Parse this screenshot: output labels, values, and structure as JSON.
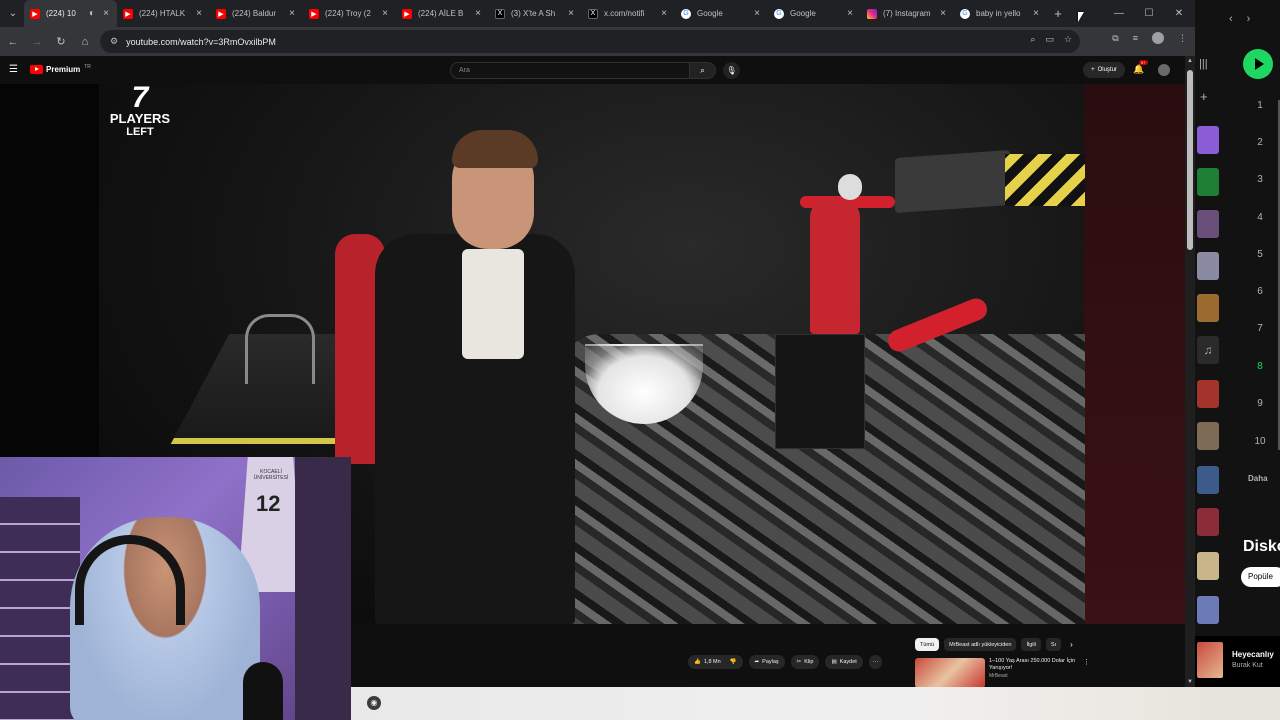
{
  "browser": {
    "tabs": [
      {
        "title": "(224) 10",
        "favicon": "youtube-icon",
        "active": true
      },
      {
        "title": "(224) HTALK",
        "favicon": "youtube-icon",
        "active": false
      },
      {
        "title": "(224) Baldur",
        "favicon": "youtube-icon",
        "active": false
      },
      {
        "title": "(224) Troy (2",
        "favicon": "youtube-icon",
        "active": false
      },
      {
        "title": "(224) AİLE B",
        "favicon": "youtube-icon",
        "active": false
      },
      {
        "title": "(3) X'te A Sh",
        "favicon": "x-icon",
        "active": false
      },
      {
        "title": "x.com/notifi",
        "favicon": "x-icon",
        "active": false
      },
      {
        "title": "Google",
        "favicon": "google-icon",
        "active": false
      },
      {
        "title": "Google",
        "favicon": "google-icon",
        "active": false
      },
      {
        "title": "(7) Instagram",
        "favicon": "instagram-icon",
        "active": false
      },
      {
        "title": "baby in yello",
        "favicon": "google-icon",
        "active": false
      }
    ],
    "url": "youtube.com/watch?v=3RmOvxilbPM"
  },
  "youtube": {
    "logo_text": "Premium",
    "logo_region": "TR",
    "search_placeholder": "Ara",
    "create_label": "Oluştur",
    "notification_count": "9+",
    "video_overlay": {
      "count": "7",
      "line1": "PLAYERS",
      "line2": "LEFT"
    },
    "webcam_jersey_number": "12",
    "webcam_jersey_text": "KOCAELİ ÜNİVERSİTESİ",
    "actions": {
      "likes": "1,8 Mn",
      "share": "Paylaş",
      "clip": "Klip",
      "save": "Kaydet"
    },
    "chips": [
      "Tümü",
      "MrBeast adlı yükleyiciden",
      "İlgili",
      "Sı"
    ],
    "recommended": {
      "title": "1–100 Yaş Arası 250.000 Dolar İçin Yarışıyor!",
      "channel": "MrBeast"
    }
  },
  "music": {
    "ranks": [
      "1",
      "2",
      "3",
      "4",
      "5",
      "6",
      "7",
      "8",
      "9",
      "10"
    ],
    "active_rank": "8",
    "more_label": "Daha",
    "section_title": "Disko",
    "filter_chip": "Popüle",
    "now_playing": {
      "title": "Heyecanlıy",
      "artist": "Burak Kut"
    },
    "colors": {
      "accent": "#1ed760"
    }
  }
}
